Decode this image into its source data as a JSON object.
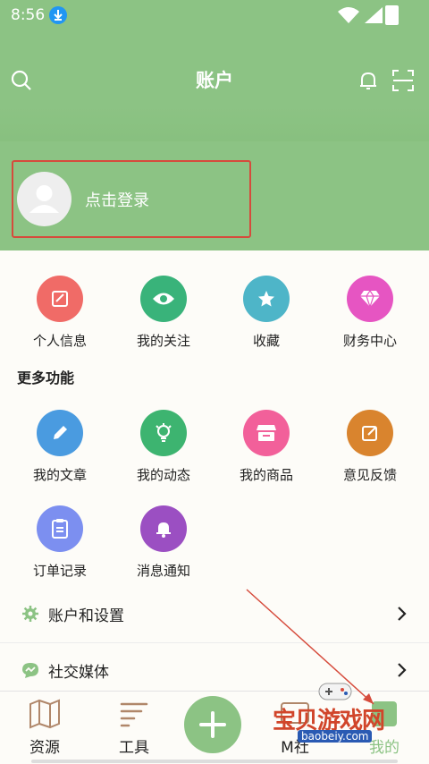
{
  "status_bar": {
    "time": "8:56"
  },
  "app_bar": {
    "title": "账户",
    "search_icon": "search-icon",
    "bell_icon": "bell-icon",
    "scan_icon": "scan-icon"
  },
  "login": {
    "text": "点击登录"
  },
  "quick_menu": [
    {
      "label": "个人信息",
      "icon": "edit-note-icon",
      "color": "#f06b67"
    },
    {
      "label": "我的关注",
      "icon": "eye-icon",
      "color": "#39b37a"
    },
    {
      "label": "收藏",
      "icon": "star-icon",
      "color": "#4eb5c8"
    },
    {
      "label": "财务中心",
      "icon": "diamond-icon",
      "color": "#e655c2"
    }
  ],
  "more": {
    "title": "更多功能",
    "items": [
      {
        "label": "我的文章",
        "icon": "pencil-icon",
        "color": "#4a9be0"
      },
      {
        "label": "我的动态",
        "icon": "bulb-icon",
        "color": "#3db470"
      },
      {
        "label": "我的商品",
        "icon": "shop-icon",
        "color": "#f2609a"
      },
      {
        "label": "意见反馈",
        "icon": "feedback-icon",
        "color": "#d9842e"
      },
      {
        "label": "订单记录",
        "icon": "clipboard-icon",
        "color": "#7c8ff0"
      },
      {
        "label": "消息通知",
        "icon": "bell-icon",
        "color": "#9b4fc2"
      }
    ]
  },
  "settings_rows": [
    {
      "label": "账户和设置",
      "icon": "gear-icon"
    },
    {
      "label": "社交媒体",
      "icon": "chat-icon"
    }
  ],
  "bottom_nav": {
    "items": [
      {
        "label": "资源",
        "icon": "map-icon"
      },
      {
        "label": "工具",
        "icon": "tools-icon"
      },
      {
        "label": "M社",
        "icon": "community-icon"
      },
      {
        "label": "我的",
        "icon": "profile-icon"
      }
    ],
    "fab_icon": "plus-icon"
  },
  "watermark": {
    "text": "宝贝游戏网",
    "url": "baobeiy.com"
  },
  "colors": {
    "accent": "#8cc384",
    "login_border": "#d64b3c"
  }
}
